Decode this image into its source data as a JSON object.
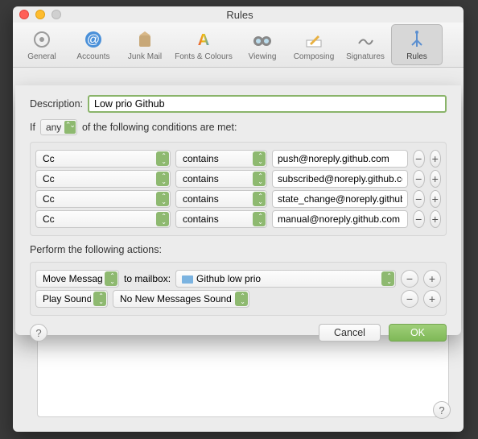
{
  "window": {
    "title": "Rules"
  },
  "toolbar": {
    "items": [
      {
        "name": "general",
        "label": "General"
      },
      {
        "name": "accounts",
        "label": "Accounts"
      },
      {
        "name": "junk",
        "label": "Junk Mail"
      },
      {
        "name": "fonts",
        "label": "Fonts & Colours"
      },
      {
        "name": "viewing",
        "label": "Viewing"
      },
      {
        "name": "composing",
        "label": "Composing"
      },
      {
        "name": "signatures",
        "label": "Signatures"
      },
      {
        "name": "rules",
        "label": "Rules"
      }
    ]
  },
  "sheet": {
    "description_label": "Description:",
    "description_value": "Low prio Github",
    "if_prefix": "If",
    "if_scope": "any",
    "if_suffix": "of the following conditions are met:",
    "conditions": [
      {
        "field": "Cc",
        "op": "contains",
        "value": "push@noreply.github.com"
      },
      {
        "field": "Cc",
        "op": "contains",
        "value": "subscribed@noreply.github.com"
      },
      {
        "field": "Cc",
        "op": "contains",
        "value": "state_change@noreply.github.com"
      },
      {
        "field": "Cc",
        "op": "contains",
        "value": "manual@noreply.github.com"
      }
    ],
    "actions_label": "Perform the following actions:",
    "actions": {
      "move": {
        "type": "Move Message",
        "to_label": "to mailbox:",
        "mailbox": "Github low prio"
      },
      "sound": {
        "type": "Play Sound",
        "value": "No New Messages Sound"
      }
    },
    "buttons": {
      "cancel": "Cancel",
      "ok": "OK",
      "help": "?"
    }
  }
}
